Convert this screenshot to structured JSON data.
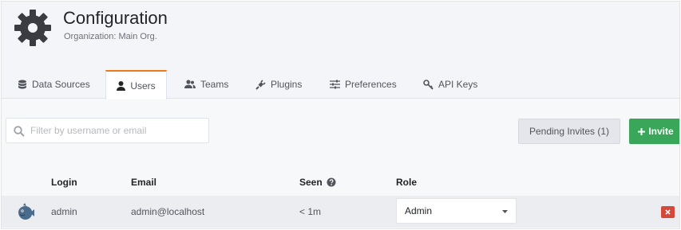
{
  "header": {
    "title": "Configuration",
    "subtitle": "Organization: Main Org."
  },
  "tabs": [
    {
      "label": "Data Sources",
      "icon": "database-icon",
      "active": false
    },
    {
      "label": "Users",
      "icon": "user-icon",
      "active": true
    },
    {
      "label": "Teams",
      "icon": "users-icon",
      "active": false
    },
    {
      "label": "Plugins",
      "icon": "plug-icon",
      "active": false
    },
    {
      "label": "Preferences",
      "icon": "sliders-icon",
      "active": false
    },
    {
      "label": "API Keys",
      "icon": "key-icon",
      "active": false
    }
  ],
  "toolbar": {
    "search_placeholder": "Filter by username or email",
    "pending_invites_label": "Pending Invites (1)",
    "invite_label": "Invite"
  },
  "table": {
    "headers": {
      "login": "Login",
      "email": "Email",
      "seen": "Seen",
      "role": "Role"
    },
    "rows": [
      {
        "login": "admin",
        "email": "admin@localhost",
        "seen": "< 1m",
        "role": "Admin"
      }
    ]
  },
  "colors": {
    "accent_tab": "#eb7b18",
    "invite_button": "#3aa65a",
    "delete_button": "#d44939"
  }
}
